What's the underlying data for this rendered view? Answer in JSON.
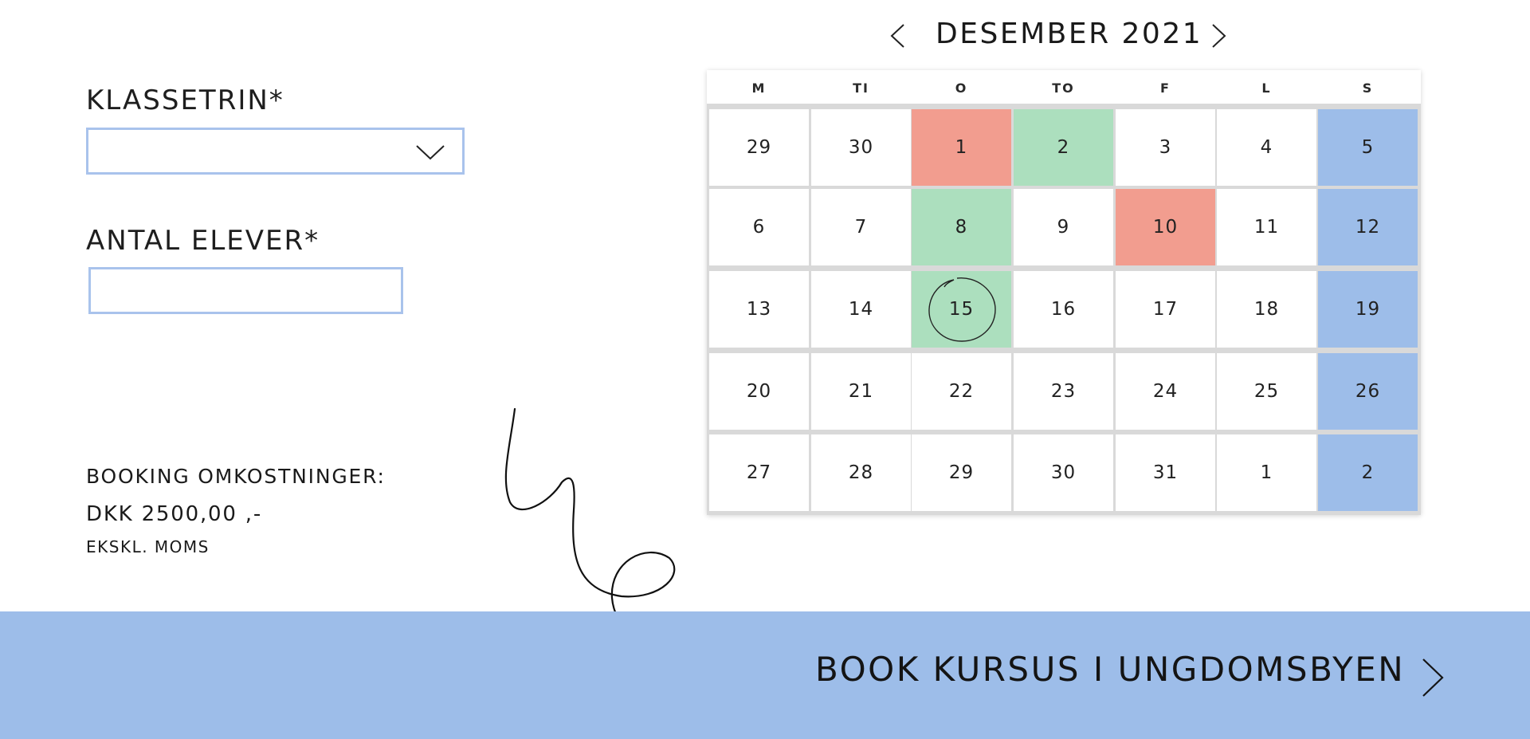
{
  "form": {
    "klassetrin_label": "KLASSETRIN*",
    "klassetrin_value": "",
    "antal_label": "ANTAL ELEVER*",
    "antal_value": ""
  },
  "cost": {
    "label": "BOOKING OMKOSTNINGER:",
    "value": "DKK 2500,00 ,-",
    "note": "EKSKL. MOMS"
  },
  "calendar": {
    "month_title": "DESEMBER 2021",
    "weekdays": [
      "M",
      "TI",
      "O",
      "TO",
      "F",
      "L",
      "S"
    ],
    "selected_day": "15",
    "weeks": [
      [
        {
          "day": "29",
          "status": "normal"
        },
        {
          "day": "30",
          "status": "normal"
        },
        {
          "day": "1",
          "status": "booked"
        },
        {
          "day": "2",
          "status": "available"
        },
        {
          "day": "3",
          "status": "normal"
        },
        {
          "day": "4",
          "status": "normal"
        },
        {
          "day": "5",
          "status": "weekend"
        }
      ],
      [
        {
          "day": "6",
          "status": "normal"
        },
        {
          "day": "7",
          "status": "normal"
        },
        {
          "day": "8",
          "status": "available"
        },
        {
          "day": "9",
          "status": "normal"
        },
        {
          "day": "10",
          "status": "booked"
        },
        {
          "day": "11",
          "status": "normal"
        },
        {
          "day": "12",
          "status": "weekend"
        }
      ],
      [
        {
          "day": "13",
          "status": "normal"
        },
        {
          "day": "14",
          "status": "normal"
        },
        {
          "day": "15",
          "status": "available"
        },
        {
          "day": "16",
          "status": "normal"
        },
        {
          "day": "17",
          "status": "normal"
        },
        {
          "day": "18",
          "status": "normal"
        },
        {
          "day": "19",
          "status": "weekend"
        }
      ],
      [
        {
          "day": "20",
          "status": "normal"
        },
        {
          "day": "21",
          "status": "normal"
        },
        {
          "day": "22",
          "status": "normal"
        },
        {
          "day": "23",
          "status": "normal"
        },
        {
          "day": "24",
          "status": "normal"
        },
        {
          "day": "25",
          "status": "normal"
        },
        {
          "day": "26",
          "status": "weekend"
        }
      ],
      [
        {
          "day": "27",
          "status": "normal"
        },
        {
          "day": "28",
          "status": "normal"
        },
        {
          "day": "29",
          "status": "normal"
        },
        {
          "day": "30",
          "status": "normal"
        },
        {
          "day": "31",
          "status": "normal"
        },
        {
          "day": "1",
          "status": "normal"
        },
        {
          "day": "2",
          "status": "weekend"
        }
      ]
    ]
  },
  "cta": {
    "label": "BOOK KURSUS I UNGDOMSBYEN"
  },
  "icons": {
    "dropdown": "chevron-down-icon",
    "prev": "chevron-left-icon",
    "next": "chevron-right-icon",
    "cta_arrow": "chevron-right-icon"
  },
  "colors": {
    "field_border": "#a9c3ec",
    "booked": "#f29d8f",
    "available": "#acdfbe",
    "weekend": "#9dbde9",
    "cta_bar": "#9dbde9"
  }
}
